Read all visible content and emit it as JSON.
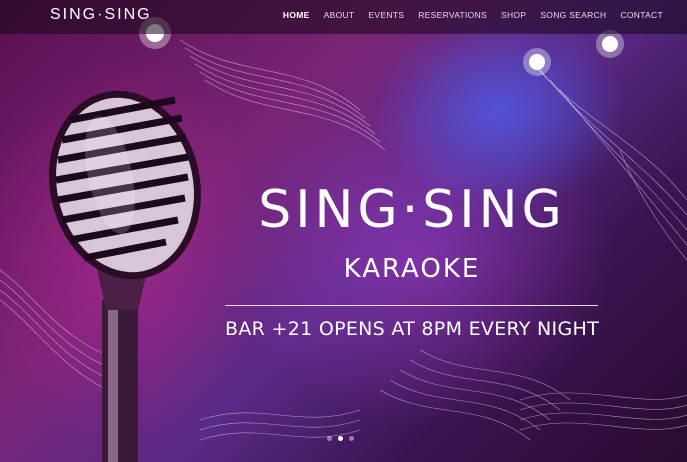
{
  "header": {
    "logo": "SING·SING",
    "nav": [
      {
        "label": "HOME",
        "active": true
      },
      {
        "label": "ABOUT",
        "active": false
      },
      {
        "label": "EVENTS",
        "active": false
      },
      {
        "label": "RESERVATIONS",
        "active": false
      },
      {
        "label": "SHOP",
        "active": false
      },
      {
        "label": "SONG SEARCH",
        "active": false
      },
      {
        "label": "CONTACT",
        "active": false
      }
    ]
  },
  "hero": {
    "title": "SING·SING",
    "subtitle": "KARAOKE",
    "tagline": "BAR +21 OPENS AT 8PM EVERY NIGHT",
    "image": "vintage-microphone-icon",
    "slides": {
      "count": 3,
      "active_index": 1
    }
  },
  "colors": {
    "background_top": "#7a2476",
    "background_bottom": "#2a0a30",
    "spotlight": "#505ae6",
    "text": "#ffffff"
  }
}
